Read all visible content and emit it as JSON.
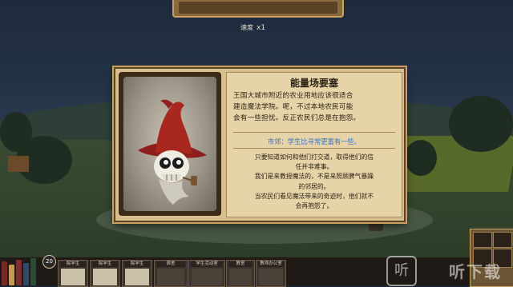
{
  "top": {
    "speed_label": "速度",
    "speed_value": "x1"
  },
  "dialog": {
    "title": "能量场要塞",
    "description_lines": [
      "王国大城市附近的农业用地应该很适合",
      "建造魔法学院。呢，不过本地农民可能",
      "会有一些担忧。反正农民们总是在抱怨。"
    ],
    "highlight": "市郊：学生比寻常更富有一些。",
    "flavor_lines": [
      "只要知道如何和他们打交道，取得他们的信",
      "任并非难事。",
      "我们是来教授魔法的，不是来照顾脾气暴躁",
      "的邻居的。",
      "当农民们看见魔法带来的奇迹时，他们就不",
      "会再抱怨了。"
    ]
  },
  "hud": {
    "counter": "20",
    "toolbar_slots": [
      {
        "label": "院学生"
      },
      {
        "label": "院学生"
      },
      {
        "label": "院学生"
      },
      {
        "label": "宿舍"
      },
      {
        "label": "学生活动室"
      },
      {
        "label": "教室"
      },
      {
        "label": "教师办公室"
      }
    ]
  },
  "watermark": {
    "icon_glyph": "听",
    "text": "听下载"
  },
  "colors": {
    "highlight": "#3a73c6",
    "paper": "#e6d4a8",
    "frame": "#5a4326"
  }
}
